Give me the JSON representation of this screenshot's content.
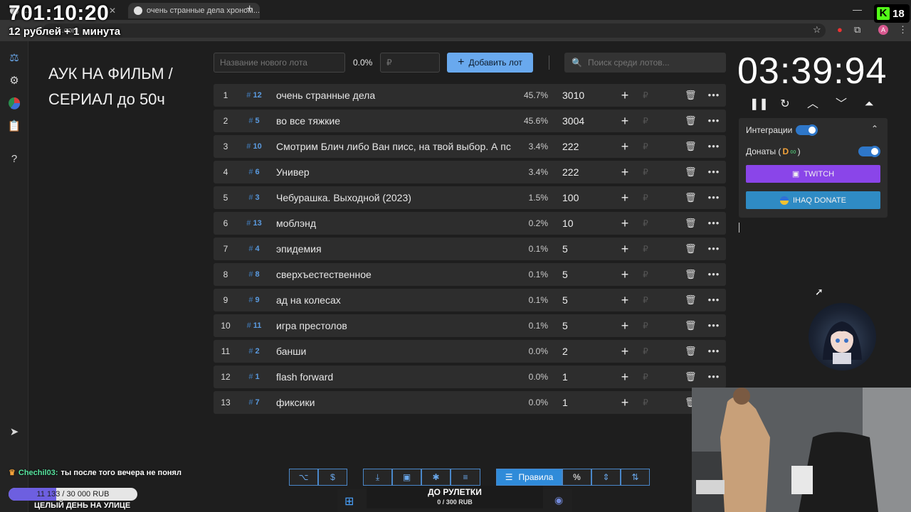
{
  "browser": {
    "tabs": [
      {
        "label": "...",
        "active": false
      },
      {
        "label": "очень странные дела хроном...",
        "active": true
      }
    ],
    "url": "...c.com"
  },
  "overlay": {
    "stream_timer": "701:10:20",
    "rate": "12 рублей + 1 минута",
    "viewer_count": "18",
    "chat_user": "Chechil03:",
    "chat_message": "ты после того вечера не понял",
    "goal": {
      "current": "11 133",
      "target": "30 000 RUB",
      "progress": 0.37
    },
    "street_label": "ЦЕЛЫЙ ДЕНЬ НА УЛИЦЕ",
    "roulette_title": "ДО РУЛЕТКИ",
    "roulette_progress": "0 / 300 RUB"
  },
  "app": {
    "title": "АУК НА ФИЛЬМ / СЕРИАЛ до 50ч",
    "new_lot_placeholder": "Название нового лота",
    "new_lot_percent": "0.0%",
    "amount_placeholder": "₽",
    "add_lot_label": "Добавить лот",
    "search_placeholder": "Поиск среди лотов..."
  },
  "lots": [
    {
      "rank": "1",
      "id": "12",
      "name": "очень странные дела",
      "percent": "45.7%",
      "amount": "3010"
    },
    {
      "rank": "2",
      "id": "5",
      "name": "во все тяжкие",
      "percent": "45.6%",
      "amount": "3004"
    },
    {
      "rank": "3",
      "id": "10",
      "name": "Смотрим Блич либо Ван писс, на твой выбор. А пс",
      "percent": "3.4%",
      "amount": "222"
    },
    {
      "rank": "4",
      "id": "6",
      "name": "Универ",
      "percent": "3.4%",
      "amount": "222"
    },
    {
      "rank": "5",
      "id": "3",
      "name": "Чебурашка. Выходной (2023)",
      "percent": "1.5%",
      "amount": "100"
    },
    {
      "rank": "6",
      "id": "13",
      "name": "моблэнд",
      "percent": "0.2%",
      "amount": "10"
    },
    {
      "rank": "7",
      "id": "4",
      "name": "эпидемия",
      "percent": "0.1%",
      "amount": "5"
    },
    {
      "rank": "8",
      "id": "8",
      "name": "сверхъестественное",
      "percent": "0.1%",
      "amount": "5"
    },
    {
      "rank": "9",
      "id": "9",
      "name": "ад на колесах",
      "percent": "0.1%",
      "amount": "5"
    },
    {
      "rank": "10",
      "id": "11",
      "name": "игра престолов",
      "percent": "0.1%",
      "amount": "5"
    },
    {
      "rank": "11",
      "id": "2",
      "name": "банши",
      "percent": "0.0%",
      "amount": "2"
    },
    {
      "rank": "12",
      "id": "1",
      "name": "flash forward",
      "percent": "0.0%",
      "amount": "1"
    },
    {
      "rank": "13",
      "id": "7",
      "name": "фиксики",
      "percent": "0.0%",
      "amount": "1"
    }
  ],
  "timer": {
    "display": "03:39:94"
  },
  "integrations": {
    "label": "Интеграции",
    "donations_label": "Донаты (",
    "donations_suffix": ")",
    "twitch_label": "TWITCH",
    "donate_label": "IHAQ DONATE"
  },
  "toolbar": {
    "rules_label": "Правила",
    "percent_symbol": "%"
  },
  "colors": {
    "accent": "#69a9ee",
    "twitch": "#8a45e9",
    "donate": "#2f8bc4",
    "lot_id": "#5b9be0",
    "kick": "#53fc18"
  }
}
